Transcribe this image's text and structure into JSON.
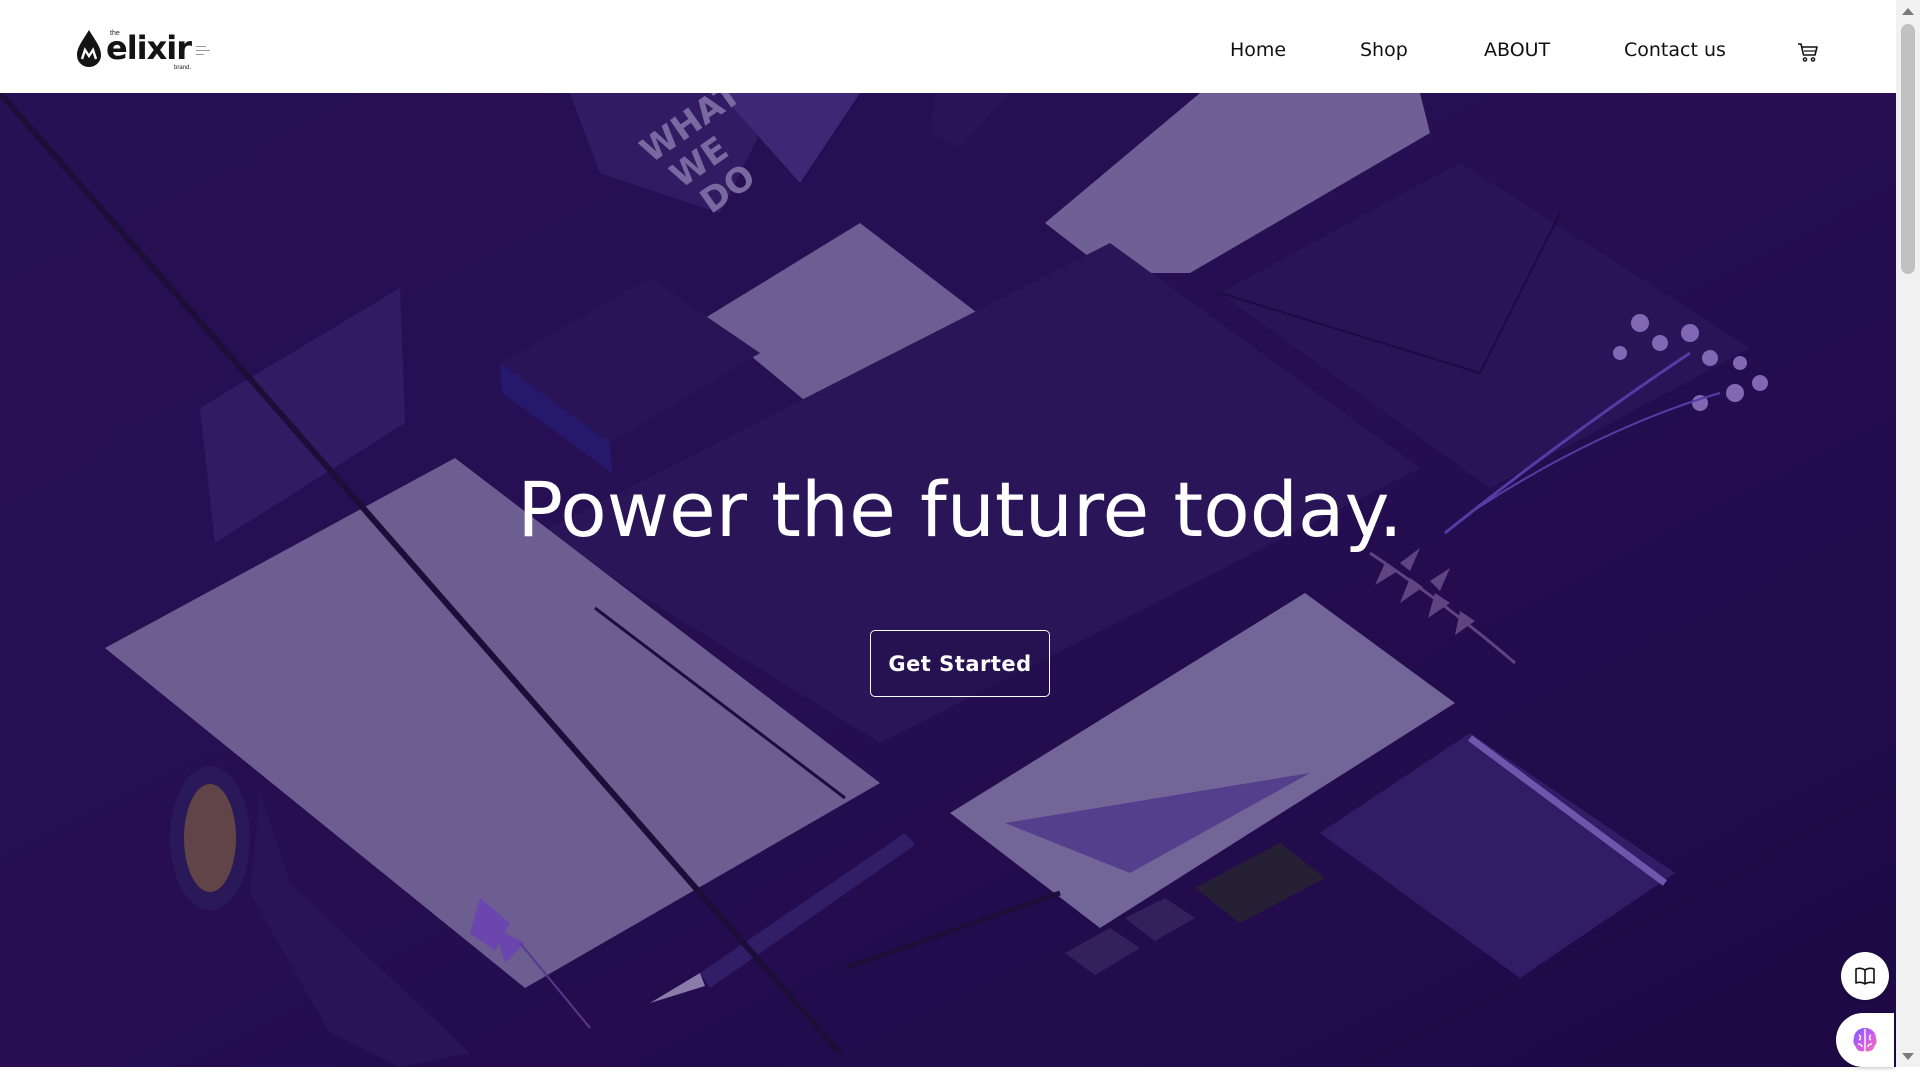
{
  "brand": {
    "name": "elixir",
    "prefix": "the",
    "suffix": "brand."
  },
  "nav": {
    "items": [
      {
        "label": "Home"
      },
      {
        "label": "Shop"
      },
      {
        "label": "ABOUT"
      },
      {
        "label": "Contact us"
      }
    ],
    "cart_icon": "cart-icon"
  },
  "hero": {
    "title": "Power the future today.",
    "cta_label": "Get Started",
    "background": "purple stationery mockup",
    "colors": {
      "base": "#2a1257",
      "paper": "#8a80ab",
      "dark_item": "#2d1a5e",
      "accent": "#b79af0"
    },
    "mockup_texts": [
      "WHAT",
      "WE",
      "DO"
    ]
  },
  "widgets": {
    "book_icon": "book-icon",
    "brain_icon": "brain-icon"
  }
}
